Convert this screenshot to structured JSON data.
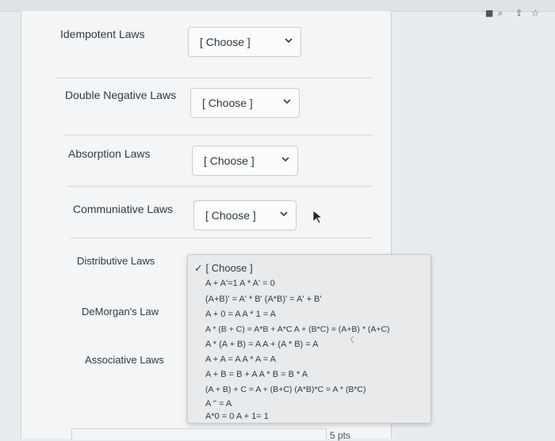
{
  "browser": {
    "icons": [
      "record-icon",
      "zoom-icon",
      "share-icon",
      "bookmark-star-icon"
    ]
  },
  "questions": [
    {
      "label": "Idempotent Laws",
      "value": "[ Choose ]"
    },
    {
      "label": "Double Negative Laws",
      "value": "[ Choose ]"
    },
    {
      "label": "Absorption Laws",
      "value": "[ Choose ]"
    },
    {
      "label": "Communiative Laws",
      "value": "[ Choose ]"
    },
    {
      "label": "Distributive Laws",
      "value": ""
    },
    {
      "label": "DeMorgan's Law",
      "value": ""
    },
    {
      "label": "Associative Laws",
      "value": ""
    }
  ],
  "dropdown": {
    "options": [
      "✓ [ Choose ]",
      "A + A'=1 A * A' = 0",
      "(A+B)' = A' * B' (A*B)' = A' + B'",
      "A + 0 = A A * 1 = A",
      "A * (B + C) = A*B + A*C A + (B*C) = (A+B) * (A+C)",
      "A * (A + B) = A A + (A * B) = A",
      "A + A = A A * A = A",
      "A + B = B + A A * B = B * A",
      "(A + B) + C = A + (B+C) (A*B)*C = A * (B*C)",
      "A '' = A",
      "A*0 = 0 A + 1= 1"
    ]
  },
  "footer": {
    "points": "5 pts"
  }
}
